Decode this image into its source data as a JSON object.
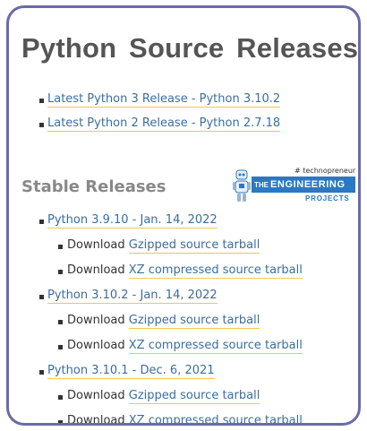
{
  "page": {
    "title": "Python Source Releases"
  },
  "latest": [
    {
      "label": "Latest Python 3 Release - Python 3.10.2"
    },
    {
      "label": "Latest Python 2 Release - Python 2.7.18"
    }
  ],
  "stable": {
    "heading": "Stable Releases",
    "releases": [
      {
        "label": "Python 3.9.10 - Jan. 14, 2022",
        "downloads": [
          {
            "prefix": "Download",
            "link": "Gzipped source tarball"
          },
          {
            "prefix": "Download",
            "link": "XZ compressed source tarball"
          }
        ]
      },
      {
        "label": "Python 3.10.2 - Jan. 14, 2022",
        "downloads": [
          {
            "prefix": "Download",
            "link": "Gzipped source tarball"
          },
          {
            "prefix": "Download",
            "link": "XZ compressed source tarball"
          }
        ]
      },
      {
        "label": "Python 3.10.1 - Dec. 6, 2021",
        "downloads": [
          {
            "prefix": "Download",
            "link": "Gzipped source tarball"
          },
          {
            "prefix": "Download",
            "link": "XZ compressed source tarball"
          }
        ]
      }
    ]
  },
  "watermark": {
    "tagline": "# technopreneur",
    "the": "THE",
    "engineering": "ENGINEERING",
    "projects": "PROJECTS",
    "colors": {
      "primary": "#2c78c2",
      "robot_body": "#e8eef5"
    }
  },
  "colors": {
    "link": "#3b6e9e",
    "underline": "#f0c94a",
    "frame": "#6a6aa8",
    "heading": "#555555"
  }
}
